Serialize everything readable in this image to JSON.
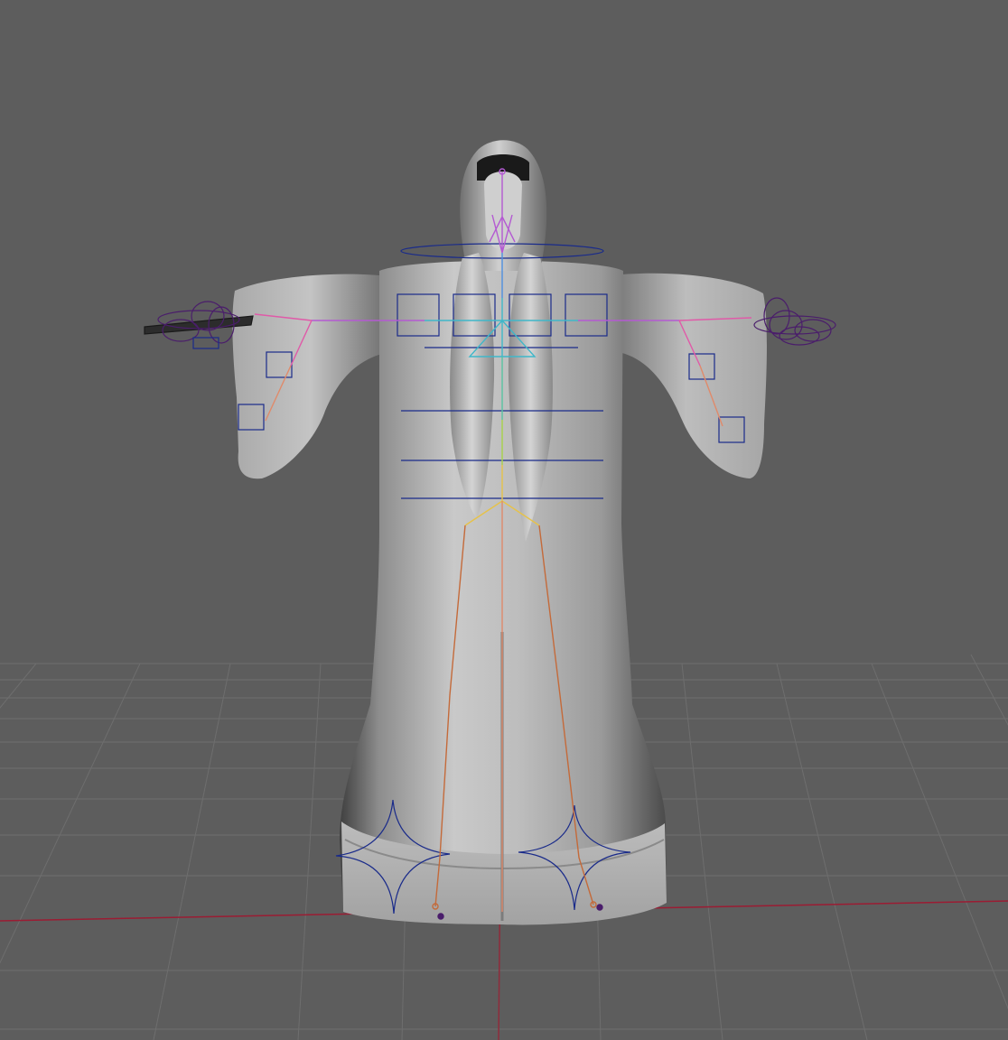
{
  "viewport": {
    "background": "#5d5d5d",
    "grid_color": "#6e6e6e",
    "axis_x_color": "#9b1c33",
    "axis_z_color": "#8f2b3b"
  },
  "rig": {
    "joint_colors": {
      "head": "#b45ad2",
      "neck": "#4f8fe0",
      "spine_upper": "#3fb7c9",
      "spine_mid": "#7acb6a",
      "spine_low": "#c8d24a",
      "hips": "#e6c24a",
      "legs": "#c46a3a",
      "arms_inner": "#b45ad2",
      "arms_outer": "#e05aa8",
      "elbows": "#e08a6a"
    },
    "control_color": "#1a2b8a",
    "hand_control_color": "#4a1d6b"
  }
}
